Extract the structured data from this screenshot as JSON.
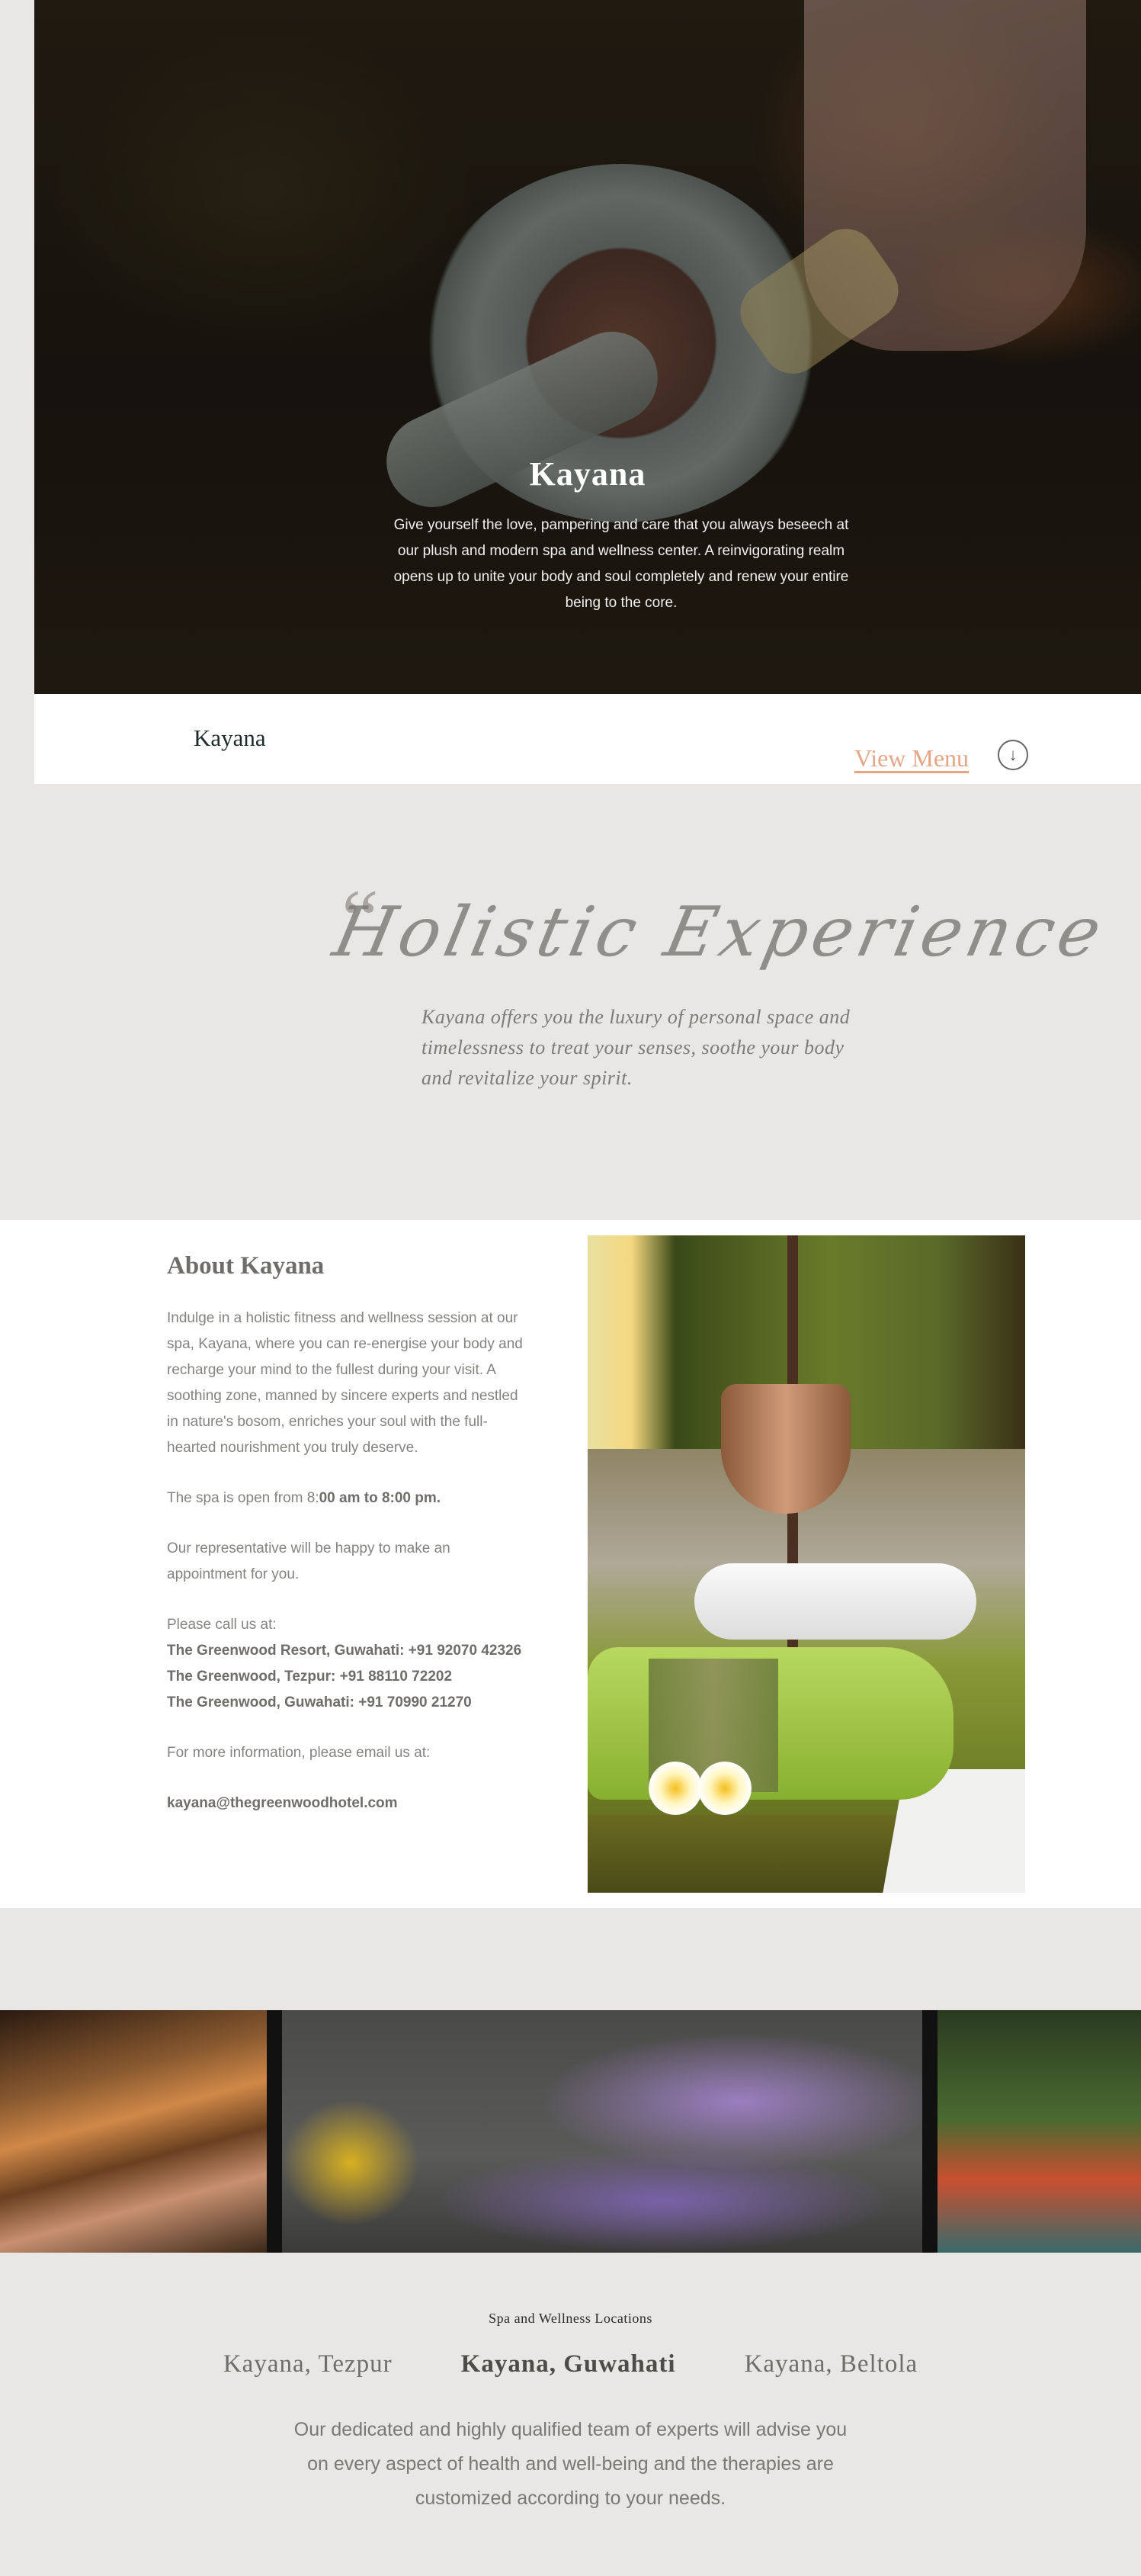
{
  "hero": {
    "title": "Kayana",
    "description": "Give yourself the love, pampering and care that you always beseech at our plush and modern spa and wellness center. A reinvigorating realm opens up to unite your body and soul completely and renew your entire being to the core."
  },
  "navbar": {
    "brand": "Kayana",
    "view_menu_label": "View Menu",
    "down_icon": "chevron-down-circle-icon",
    "down_glyph": "↓"
  },
  "holistic": {
    "quote_glyph": "“",
    "heading": "Holistic Experience",
    "text": "Kayana offers you the luxury of personal space and timelessness to treat your senses, soothe your body and revitalize your spirit."
  },
  "about": {
    "title": "About Kayana",
    "intro": "Indulge in a holistic fitness and wellness session at our spa, Kayana, where you can re-energise your body and recharge your mind to the fullest during your visit. A soothing zone, manned by sincere experts and nestled in nature's bosom, enriches your soul with the full-hearted nourishment you truly deserve.",
    "hours_prefix": "The spa is open from 8:",
    "hours_bold": "00 am to 8:00 pm.",
    "representative": "Our representative will be happy to make an appointment for you.",
    "call_label": "Please call us at:",
    "contacts": [
      {
        "name": "The Greenwood Resort, Guwahati:",
        "phone": "+91 92070 42326"
      },
      {
        "name": "The Greenwood, Tezpur:",
        "phone": "+91 88110 72202"
      },
      {
        "name": "The Greenwood, Guwahati:",
        "phone": "+91 70990 21270"
      }
    ],
    "email_label": "For more information, please email us at:",
    "email": "kayana@thegreenwoodhotel.com"
  },
  "locations": {
    "heading": "Spa and Wellness Locations",
    "items": [
      {
        "label": "Kayana, Tezpur",
        "active": false
      },
      {
        "label": "Kayana, Guwahati",
        "active": true
      },
      {
        "label": "Kayana, Beltola",
        "active": false
      }
    ],
    "text": "Our dedicated and highly qualified team of experts will advise you on every aspect of health and well-being and the therapies are customized according to your needs."
  },
  "colors": {
    "accent": "#e5a587",
    "background": "#e8e7e5",
    "text": "#858380"
  }
}
